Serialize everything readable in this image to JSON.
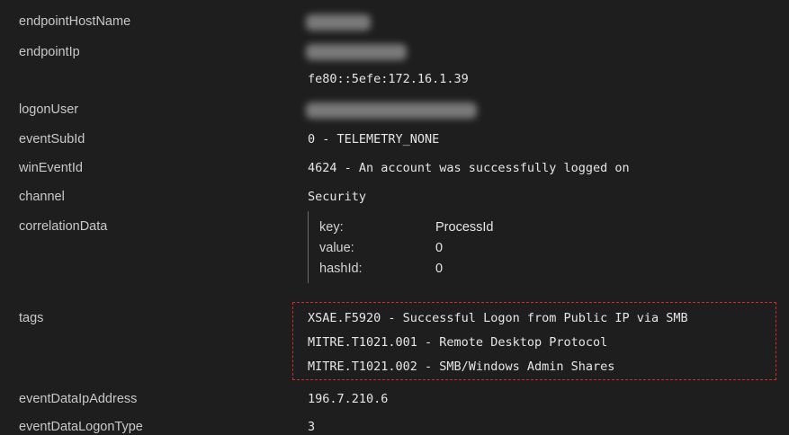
{
  "rows": {
    "endpointHostName": {
      "key": "endpointHostName"
    },
    "endpointIp": {
      "key": "endpointIp",
      "value2": "fe80::5efe:172.16.1.39"
    },
    "logonUser": {
      "key": "logonUser"
    },
    "eventSubId": {
      "key": "eventSubId",
      "value": "0 - TELEMETRY_NONE"
    },
    "winEventId": {
      "key": "winEventId",
      "value": "4624 - An account was successfully logged on"
    },
    "channel": {
      "key": "channel",
      "value": "Security"
    },
    "correlationData": {
      "key": "correlationData",
      "fields": [
        {
          "key": "key:",
          "value": "ProcessId"
        },
        {
          "key": "value:",
          "value": "0"
        },
        {
          "key": "hashId:",
          "value": "0"
        }
      ]
    },
    "tags": {
      "key": "tags",
      "values": [
        "XSAE.F5920 - Successful Logon from Public IP via SMB",
        "MITRE.T1021.001 - Remote Desktop Protocol",
        "MITRE.T1021.002 - SMB/Windows Admin Shares"
      ]
    },
    "eventDataIpAddress": {
      "key": "eventDataIpAddress",
      "value": "196.7.210.6"
    },
    "eventDataLogonType": {
      "key": "eventDataLogonType",
      "value": "3"
    }
  },
  "highlight_color": "#d22a2a"
}
